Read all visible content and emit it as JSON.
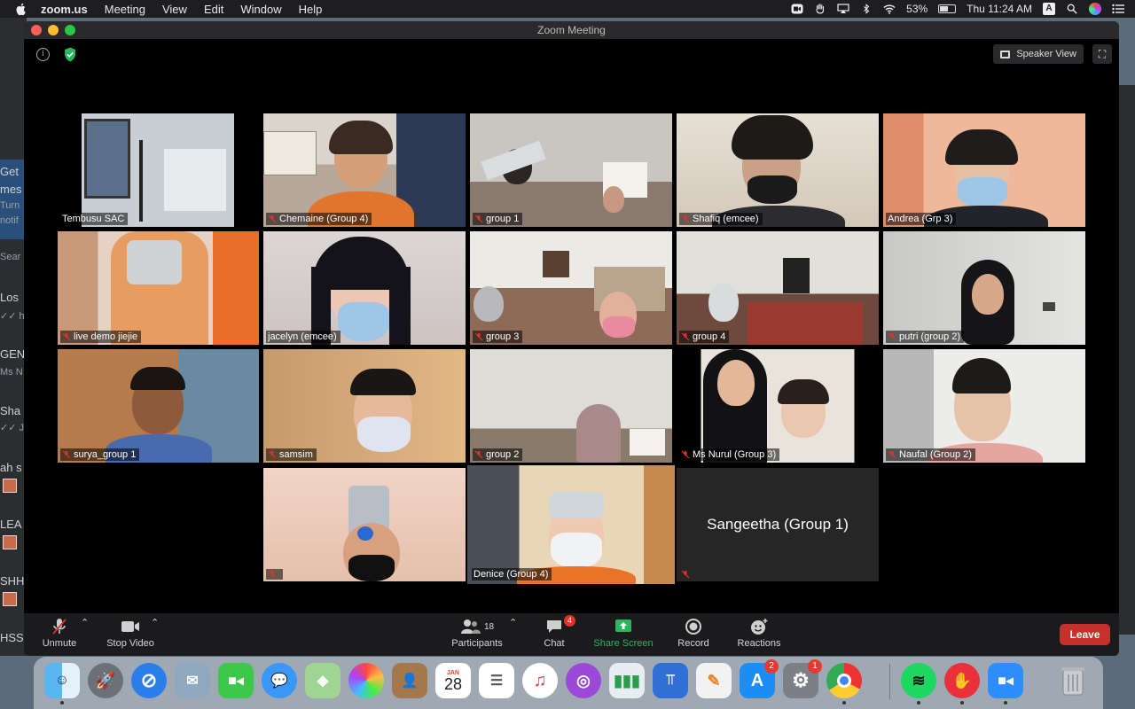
{
  "menubar": {
    "app": "zoom.us",
    "menus": [
      "Meeting",
      "View",
      "Edit",
      "Window",
      "Help"
    ],
    "battery": "53%",
    "clock": "Thu 11:24 AM",
    "input_source": "A"
  },
  "background_window": {
    "snippets": [
      {
        "text": "Get",
        "size": "normal"
      },
      {
        "text": "mes",
        "size": "normal"
      },
      {
        "text": "Turn",
        "size": "small"
      },
      {
        "text": "notif",
        "size": "small"
      },
      {
        "text": "Sear",
        "size": "small"
      },
      {
        "text": "Los",
        "size": "normal"
      },
      {
        "text": "✓✓ h",
        "size": "small"
      },
      {
        "text": "GEN",
        "size": "normal"
      },
      {
        "text": "Ms N",
        "size": "small"
      },
      {
        "text": "Sha",
        "size": "normal"
      },
      {
        "text": "✓✓ J",
        "size": "small"
      },
      {
        "text": "ah s",
        "size": "normal"
      },
      {
        "text": "LEA",
        "size": "normal"
      },
      {
        "text": "SHH",
        "size": "normal"
      },
      {
        "text": "HSS",
        "size": "normal"
      }
    ]
  },
  "window": {
    "title": "Zoom Meeting",
    "view_button": "Speaker View"
  },
  "participants": [
    {
      "name": "Tembusu SAC",
      "muted": false
    },
    {
      "name": "Chemaine (Group 4)",
      "muted": true
    },
    {
      "name": "group 1",
      "muted": true
    },
    {
      "name": "Shafiq (emcee)",
      "muted": true
    },
    {
      "name": "Andrea (Grp 3)",
      "muted": false
    },
    {
      "name": "live demo jiejie",
      "muted": true
    },
    {
      "name": "jacelyn (emcee)",
      "muted": false
    },
    {
      "name": "group 3",
      "muted": true
    },
    {
      "name": "group 4",
      "muted": true
    },
    {
      "name": "putri (group 2)",
      "muted": true
    },
    {
      "name": "surya_group 1",
      "muted": true
    },
    {
      "name": "samsim",
      "muted": true
    },
    {
      "name": "group 2",
      "muted": true
    },
    {
      "name": "Ms Nurul (Group 3)",
      "muted": true
    },
    {
      "name": "Naufal (Group 2)",
      "muted": true
    },
    {
      "name": "",
      "muted": true
    },
    {
      "name": "Denice (Group 4)",
      "muted": false,
      "active_speaker": true
    },
    {
      "name": "Sangeetha (Group 1)",
      "muted": true,
      "video_off": true
    }
  ],
  "toolbar": {
    "unmute": "Unmute",
    "stop_video": "Stop Video",
    "participants": "Participants",
    "participant_count": "18",
    "chat": "Chat",
    "chat_badge": "4",
    "share_screen": "Share Screen",
    "record": "Record",
    "reactions": "Reactions",
    "leave": "Leave"
  },
  "dock": {
    "calendar_month": "JAN",
    "calendar_day": "28",
    "app_store_badge": "2",
    "system_prefs_badge": "1"
  },
  "colors": {
    "share_screen": "#2db55d",
    "leave": "#c8312b",
    "active_speaker_border": "#e8f28c"
  }
}
